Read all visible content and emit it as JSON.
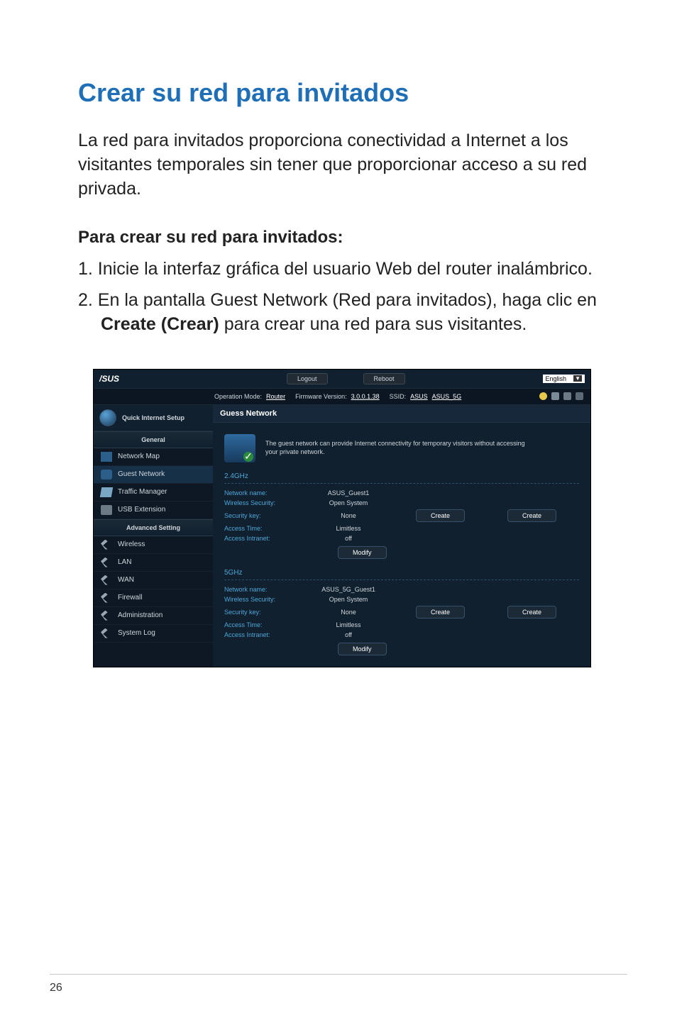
{
  "page_number": "26",
  "heading": "Crear su red para invitados",
  "intro": "La red para invitados proporciona conectividad a Internet a los visitantes temporales sin tener que proporcionar acceso a su red privada.",
  "subheading": "Para crear su red para invitados:",
  "steps": {
    "s1": "1.  Inicie la interfaz gráfica del usuario Web del router inalámbrico.",
    "s2_prefix": "2.  En la pantalla Guest Network (Red para invitados), haga clic en ",
    "s2_bold": "Create (Crear)",
    "s2_suffix": " para crear una red para sus visitantes."
  },
  "ui": {
    "logo": "/SUS",
    "top_buttons": {
      "logout": "Logout",
      "reboot": "Reboot"
    },
    "language": "English",
    "status": {
      "op_mode_label": "Operation Mode:",
      "op_mode_value": "Router",
      "fw_label": "Firmware Version:",
      "fw_value": "3.0.0.1.38",
      "ssid_label": "SSID:",
      "ssid1": "ASUS",
      "ssid2": "ASUS_5G"
    },
    "qis": "Quick Internet Setup",
    "sections": {
      "general": "General",
      "advanced": "Advanced Setting"
    },
    "nav": {
      "network_map": "Network Map",
      "guest_network": "Guest Network",
      "traffic_manager": "Traffic Manager",
      "usb_extension": "USB Extension",
      "wireless": "Wireless",
      "lan": "LAN",
      "wan": "WAN",
      "firewall": "Firewall",
      "administration": "Administration",
      "system_log": "System Log"
    },
    "panel_title": "Guess Network",
    "panel_desc": "The guest network can provide Internet connectivity for temporary visitors without accessing your private network.",
    "bands": {
      "b24": "2.4GHz",
      "b5": "5GHz"
    },
    "labels": {
      "network_name": "Network name:",
      "wireless_security": "Wireless Security:",
      "security_key": "Security key:",
      "access_time": "Access Time:",
      "access_intranet": "Access Intranet:"
    },
    "values": {
      "ssid24": "ASUS_Guest1",
      "ssid5": "ASUS_5G_Guest1",
      "security": "Open System",
      "key": "None",
      "time": "Limitless",
      "intranet": "off"
    },
    "buttons": {
      "create": "Create",
      "modify": "Modify"
    }
  }
}
